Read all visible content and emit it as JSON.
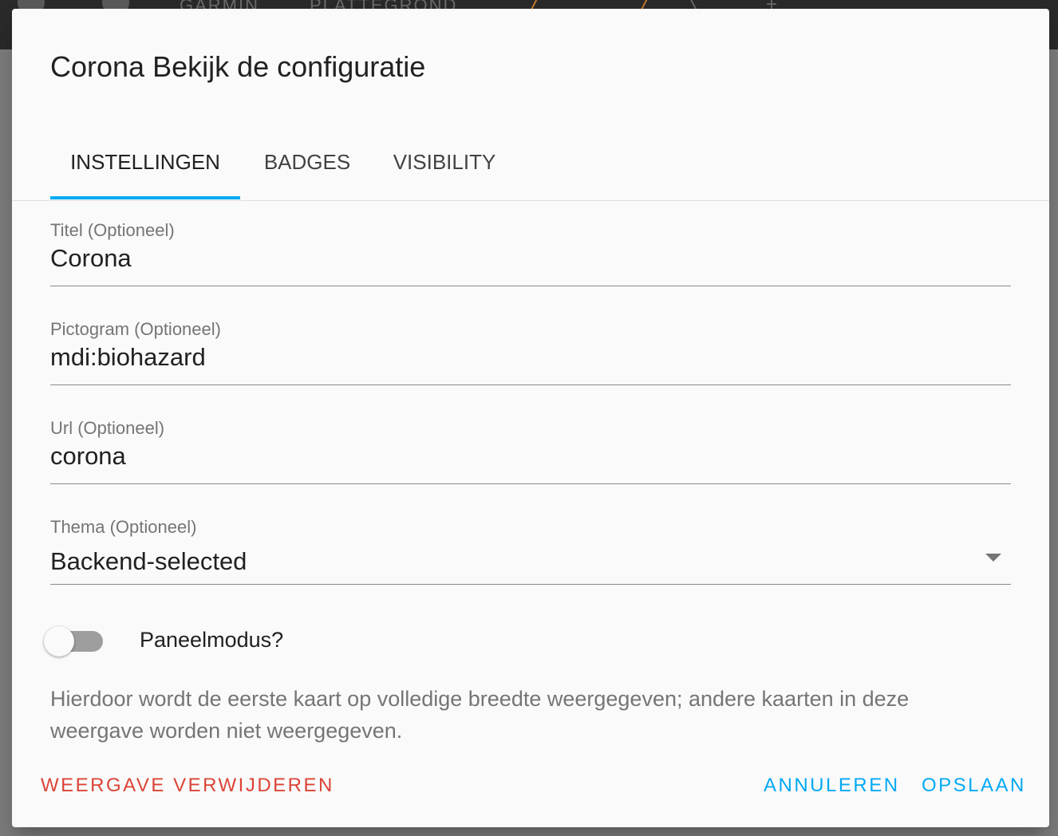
{
  "background": {
    "topbar_labels": [
      "GARMIN",
      "PLATTEGROND"
    ]
  },
  "dialog": {
    "title": "Corona Bekijk de configuratie",
    "tabs": [
      {
        "label": "INSTELLINGEN",
        "active": true
      },
      {
        "label": "BADGES",
        "active": false
      },
      {
        "label": "VISIBILITY",
        "active": false
      }
    ],
    "fields": {
      "title": {
        "label": "Titel (Optioneel)",
        "value": "Corona"
      },
      "icon": {
        "label": "Pictogram (Optioneel)",
        "value": "mdi:biohazard"
      },
      "url": {
        "label": "Url (Optioneel)",
        "value": "corona"
      },
      "theme": {
        "label": "Thema (Optioneel)",
        "value": "Backend-selected"
      }
    },
    "panel_mode": {
      "label": "Paneelmodus?",
      "enabled": false,
      "help": "Hierdoor wordt de eerste kaart op volledige breedte weergegeven; andere kaarten in deze weergave worden niet weergegeven."
    },
    "buttons": {
      "delete": "WEERGAVE VERWIJDEREN",
      "cancel": "ANNULEREN",
      "save": "OPSLAAN"
    }
  },
  "colors": {
    "accent": "#03a9f4",
    "danger": "#db4437",
    "dialog_bg": "#fafafa",
    "overlay": "#7d7d7d"
  }
}
